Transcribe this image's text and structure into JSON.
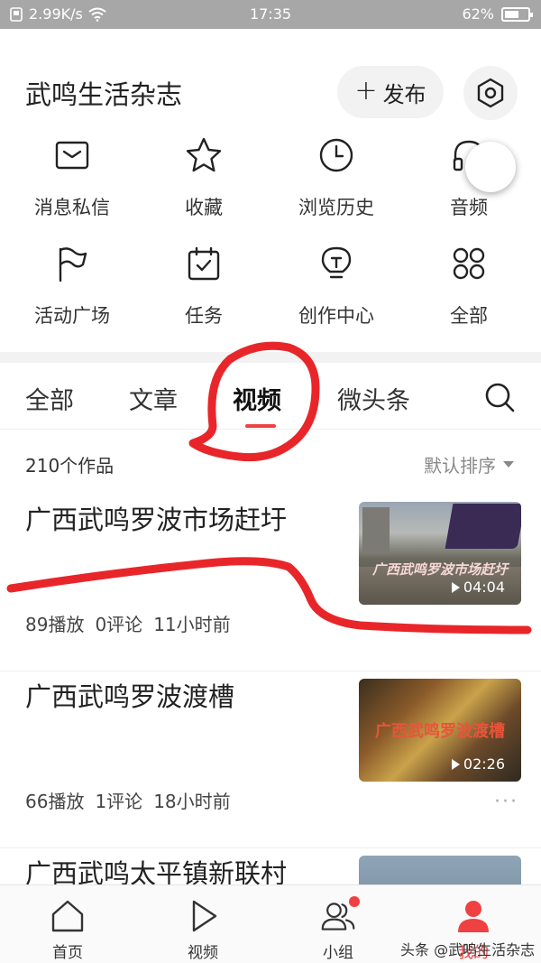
{
  "status_bar": {
    "speed": "2.99K/s",
    "time": "17:35",
    "battery": "62%",
    "battery_level": 0.62
  },
  "header": {
    "title": "武鸣生活杂志",
    "publish_label": "发布"
  },
  "grid": [
    {
      "label": "消息私信",
      "icon": "mail-icon"
    },
    {
      "label": "收藏",
      "icon": "star-icon"
    },
    {
      "label": "浏览历史",
      "icon": "clock-icon"
    },
    {
      "label": "音频",
      "icon": "headphones-icon"
    },
    {
      "label": "活动广场",
      "icon": "flag-icon"
    },
    {
      "label": "任务",
      "icon": "calendar-check-icon"
    },
    {
      "label": "创作中心",
      "icon": "lightbulb-icon"
    },
    {
      "label": "全部",
      "icon": "grid-icon"
    }
  ],
  "tabs": [
    "全部",
    "文章",
    "视频",
    "微头条"
  ],
  "active_tab": "视频",
  "subheader": {
    "count": "210个作品",
    "sort_label": "默认排序"
  },
  "items": [
    {
      "title": "广西武鸣罗波市场赶圩",
      "duration": "04:04",
      "overlay": "广西武鸣罗波市场赶圩",
      "plays": "89播放",
      "comments": "0评论",
      "time": "11小时前"
    },
    {
      "title": "广西武鸣罗波渡槽",
      "duration": "02:26",
      "overlay": "广西武鸣罗波渡槽",
      "plays": "66播放",
      "comments": "1评论",
      "time": "18小时前"
    },
    {
      "title": "广西武鸣太平镇新联村"
    }
  ],
  "bottom_nav": [
    {
      "label": "首页",
      "icon": "home-icon"
    },
    {
      "label": "视频",
      "icon": "play-icon"
    },
    {
      "label": "小组",
      "icon": "group-icon"
    },
    {
      "label": "我的",
      "icon": "profile-icon"
    }
  ],
  "watermark": "头条 @武鸣生活杂志",
  "colors": {
    "accent": "#f04142",
    "annotation": "#e8262a"
  }
}
